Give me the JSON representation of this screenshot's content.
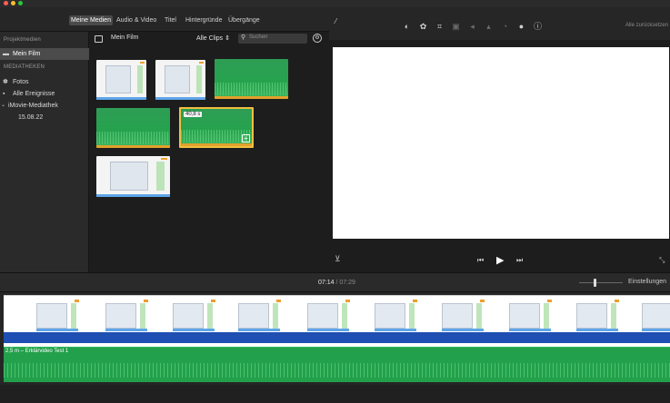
{
  "window": {
    "traffic_colors": [
      "#ff5f57",
      "#febc2e",
      "#28c840"
    ]
  },
  "tabs": [
    {
      "label": "Meine Medien",
      "active": true
    },
    {
      "label": "Audio & Video",
      "active": false
    },
    {
      "label": "Titel",
      "active": false
    },
    {
      "label": "Hintergründe",
      "active": false
    },
    {
      "label": "Übergänge",
      "active": false
    }
  ],
  "sidebar": {
    "project_heading": "Projektmedien",
    "project_item": "Mein Film",
    "libraries_heading": "MEDIATHEKEN",
    "items": [
      {
        "label": "Fotos",
        "icon": "flower-icon"
      },
      {
        "label": "Alle Ereignisse",
        "icon": "star-icon"
      }
    ],
    "library": {
      "label": "iMovie-Mediathek",
      "event": "15.08.22"
    }
  },
  "browser": {
    "project_title": "Mein Film",
    "filter_label": "Alle Clips",
    "search_placeholder": "Suchen",
    "clips": [
      {
        "kind": "screen"
      },
      {
        "kind": "screen"
      },
      {
        "kind": "audio"
      },
      {
        "kind": "audio"
      },
      {
        "kind": "audio",
        "badge": "40,8 s",
        "selected": true
      },
      {
        "kind": "screen"
      }
    ]
  },
  "viewer": {
    "reset_label": "Alle zurücksetzen",
    "tools": [
      "color-balance-icon",
      "color-correction-icon",
      "crop-icon",
      "stabilization-icon",
      "volume-icon",
      "noise-reduction-icon",
      "speed-icon",
      "clip-filter-icon",
      "info-icon"
    ]
  },
  "timeline": {
    "current_time": "07:14",
    "total_time": "07:29",
    "settings_label": "Einstellungen",
    "audio_clip_label": "2,5 m – Erklärvideo Test 1"
  },
  "colors": {
    "accent_green": "#23a04b",
    "track_blue": "#1f4fb3",
    "selection_border": "#f0c040"
  }
}
